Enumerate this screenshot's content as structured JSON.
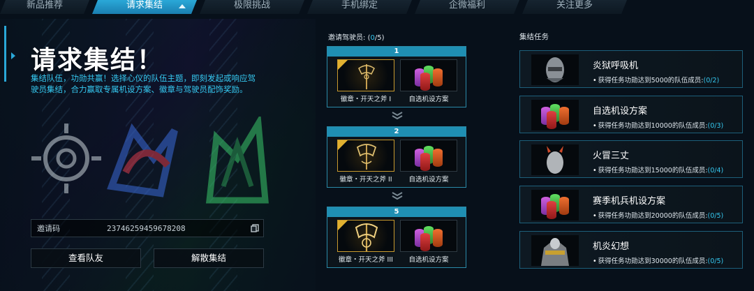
{
  "tabs": [
    {
      "label": "新品推荐",
      "active": false
    },
    {
      "label": "请求集结",
      "active": true
    },
    {
      "label": "极限挑战",
      "active": false
    },
    {
      "label": "手机绑定",
      "active": false
    },
    {
      "label": "企微福利",
      "active": false
    },
    {
      "label": "关注更多",
      "active": false
    }
  ],
  "left": {
    "title": "请求集结！",
    "description": "集结队伍，功勋共赢！选择心仪的队伍主题，即刻发起或响应驾\n驶员集结，合力赢取专属机设方案、徽章与驾驶员配饰奖励。",
    "invite_label": "邀请码",
    "invite_code": "23746259459678208",
    "btn_view": "查看队友",
    "btn_disband": "解散集结"
  },
  "middle": {
    "header_label": "邀请驾驶员:",
    "header_open": "(",
    "header_current": "0",
    "header_total": "/5)",
    "rungs": [
      {
        "level": "1",
        "badge": "徽章・开天之斧 I",
        "reward": "自选机设方案"
      },
      {
        "level": "2",
        "badge": "徽章・开天之斧 II",
        "reward": "自选机设方案"
      },
      {
        "level": "5",
        "badge": "徽章・开天之斧 III",
        "reward": "自选机设方案"
      }
    ]
  },
  "right": {
    "header": "集结任务",
    "tasks": [
      {
        "name": "炎狱呼吸机",
        "desc": "获得任务功勋达到5000的队伍成员:",
        "progress": "(0/2)",
        "thumb": "mask-icon"
      },
      {
        "name": "自选机设方案",
        "desc": "获得任务功勋达到10000的队伍成员:",
        "progress": "(0/3)",
        "thumb": "paint-cans-icon"
      },
      {
        "name": "火冒三丈",
        "desc": "获得任务功勋达到15000的队伍成员:",
        "progress": "(0/4)",
        "thumb": "horned-head-icon"
      },
      {
        "name": "赛季机兵机设方案",
        "desc": "获得任务功勋达到20000的队伍成员:",
        "progress": "(0/5)",
        "thumb": "paint-cans-icon"
      },
      {
        "name": "机炎幻想",
        "desc": "获得任务功勋达到30000的队伍成员:",
        "progress": "(0/5)",
        "thumb": "armor-icon"
      }
    ]
  },
  "colors": {
    "accent": "#2aa8d8",
    "highlight": "#35c8f0",
    "gold": "#c89a2e"
  }
}
